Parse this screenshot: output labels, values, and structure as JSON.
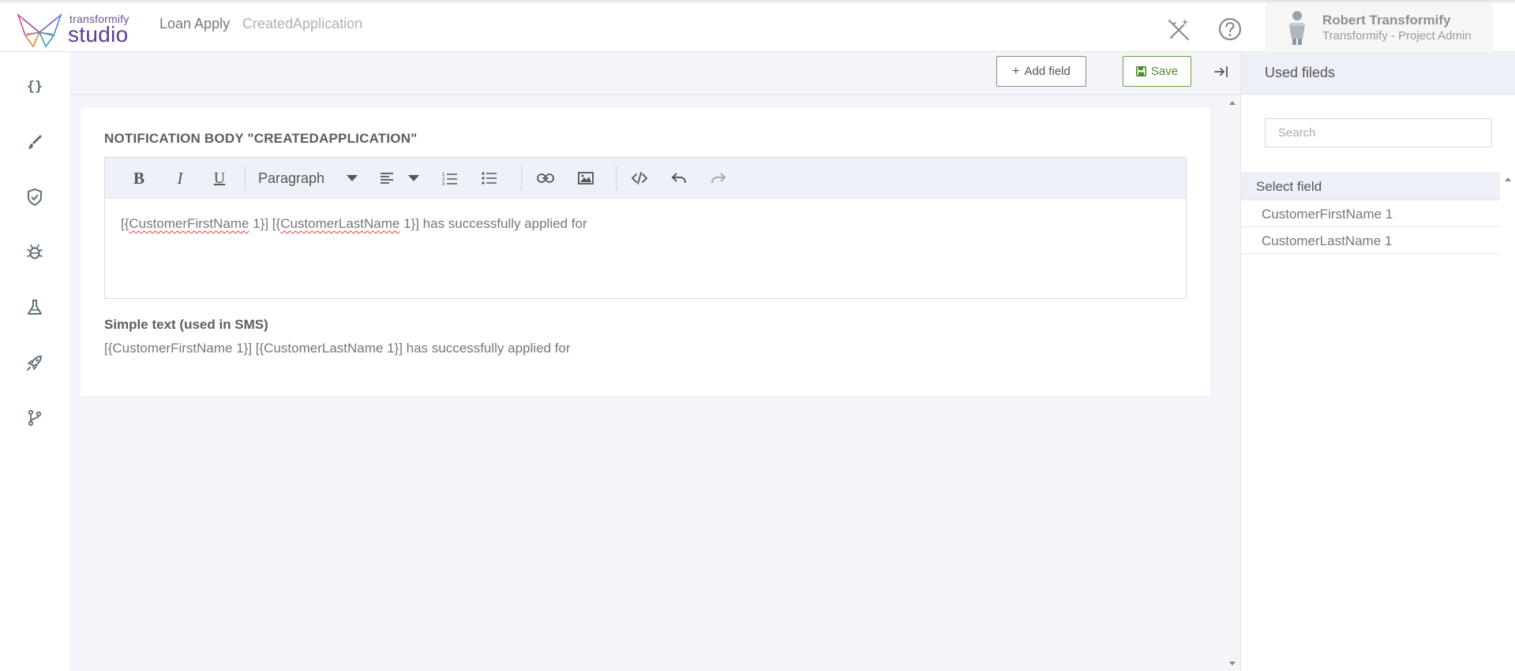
{
  "colors": {
    "brand_purple": "#5b3e91",
    "save_green": "#4f8a2a",
    "main_bg": "#f4f5fa",
    "toolbar_bg": "#eff1f9",
    "spellcheck_red": "#e23b3b"
  },
  "header": {
    "logo_small": "transformify",
    "logo_big": "studio",
    "breadcrumb": [
      "Loan Apply",
      "CreatedApplication"
    ],
    "icons": [
      "magic-wand-icon",
      "help-circle-icon"
    ],
    "user": {
      "name": "Robert Transformify",
      "role": "Transformify - Project Admin"
    }
  },
  "sidebar": {
    "items": [
      {
        "icon": "braces-icon",
        "glyph": "{}"
      },
      {
        "icon": "brush-icon"
      },
      {
        "icon": "shield-check-icon"
      },
      {
        "icon": "bug-icon"
      },
      {
        "icon": "flask-icon"
      },
      {
        "icon": "rocket-icon"
      },
      {
        "icon": "git-branch-icon"
      }
    ]
  },
  "toolbar": {
    "add_field_label": "Add field",
    "save_label": "Save"
  },
  "card": {
    "title": "NOTIFICATION BODY \"CREATEDAPPLICATION\"",
    "editor": {
      "paragraph_format": "Paragraph",
      "tools": [
        "bold-icon",
        "italic-icon",
        "underline-icon",
        "paragraph-dropdown",
        "align-left-icon",
        "ordered-list-icon",
        "unordered-list-icon",
        "link-icon",
        "image-icon",
        "code-icon",
        "undo-icon",
        "redo-icon"
      ],
      "content": {
        "p1": "[{",
        "f1": "CustomerFirstName",
        "p2": " 1}] [{",
        "f2": "CustomerLastName",
        "p3": " 1}] has successfully applied for"
      }
    },
    "simple_label": "Simple text (used in SMS)",
    "simple_text": "[{CustomerFirstName 1}] [{CustomerLastName 1}] has successfully applied for"
  },
  "right_panel": {
    "title": "Used fileds",
    "search_placeholder": "Search",
    "select_header": "Select field",
    "fields": [
      "CustomerFirstName 1",
      "CustomerLastName 1"
    ]
  }
}
